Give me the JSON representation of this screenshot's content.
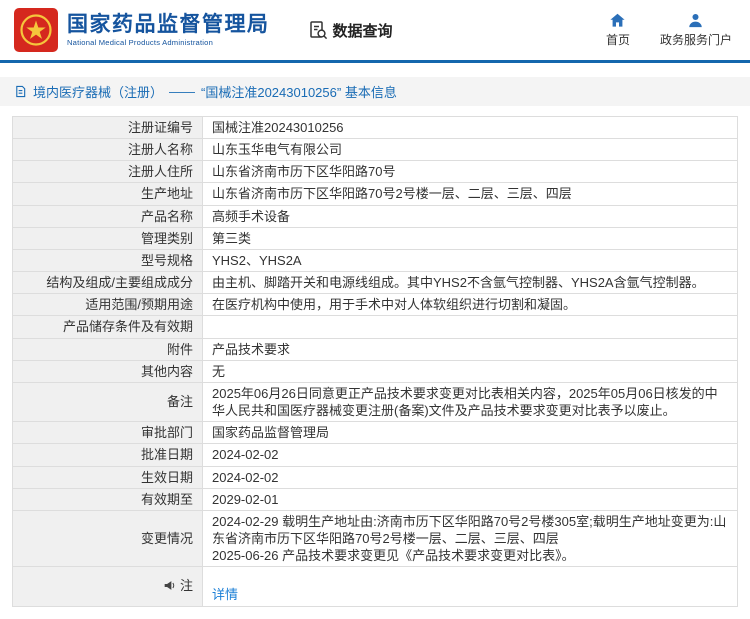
{
  "colors": {
    "brand_blue": "#15549e",
    "logo_red": "#d5281e",
    "divider_blue": "#1467ad",
    "link_blue": "#1b7fd6",
    "label_cell_bg": "#f0f0f0",
    "breadcrumb_bg": "#f4f4f4"
  },
  "header": {
    "logo_icon": "npma-emblem-icon",
    "org_name_cn": "国家药品监督管理局",
    "org_name_en": "National Medical Products Administration",
    "data_query_label": "数据查询",
    "nav": [
      {
        "label": "首页",
        "icon": "home-icon"
      },
      {
        "label": "政务服务门户",
        "icon": "user-icon"
      }
    ]
  },
  "breadcrumb": {
    "icon": "document-icon",
    "section": "境内医疗器械（注册）",
    "separator": "——",
    "current": "“国械注准20243010256” 基本信息"
  },
  "table": {
    "rows": [
      {
        "label": "注册证编号",
        "value": "国械注准20243010256"
      },
      {
        "label": "注册人名称",
        "value": "山东玉华电气有限公司"
      },
      {
        "label": "注册人住所",
        "value": "山东省济南市历下区华阳路70号"
      },
      {
        "label": "生产地址",
        "value": "山东省济南市历下区华阳路70号2号楼一层、二层、三层、四层"
      },
      {
        "label": "产品名称",
        "value": "高频手术设备"
      },
      {
        "label": "管理类别",
        "value": "第三类"
      },
      {
        "label": "型号规格",
        "value": "YHS2、YHS2A"
      },
      {
        "label": "结构及组成/主要组成成分",
        "value": "由主机、脚踏开关和电源线组成。其中YHS2不含氩气控制器、YHS2A含氩气控制器。"
      },
      {
        "label": "适用范围/预期用途",
        "value": "在医疗机构中使用，用于手术中对人体软组织进行切割和凝固。"
      },
      {
        "label": "产品储存条件及有效期",
        "value": ""
      },
      {
        "label": "附件",
        "value": "产品技术要求"
      },
      {
        "label": "其他内容",
        "value": "无"
      },
      {
        "label": "备注",
        "value": "2025年06月26日同意更正产品技术要求变更对比表相关内容，2025年05月06日核发的中华人民共和国医疗器械变更注册(备案)文件及产品技术要求变更对比表予以废止。"
      },
      {
        "label": "审批部门",
        "value": "国家药品监督管理局"
      },
      {
        "label": "批准日期",
        "value": "2024-02-02"
      },
      {
        "label": "生效日期",
        "value": "2024-02-02"
      },
      {
        "label": "有效期至",
        "value": "2029-02-01"
      },
      {
        "label": "变更情况",
        "value": "2024-02-29 载明生产地址由:济南市历下区华阳路70号2号楼305室;载明生产地址变更为:山东省济南市历下区华阳路70号2号楼一层、二层、三层、四层\n2025-06-26 产品技术要求变更见《产品技术要求变更对比表》。"
      }
    ],
    "note_row": {
      "icon": "megaphone-icon",
      "label": "注",
      "link_label": "详情"
    }
  }
}
